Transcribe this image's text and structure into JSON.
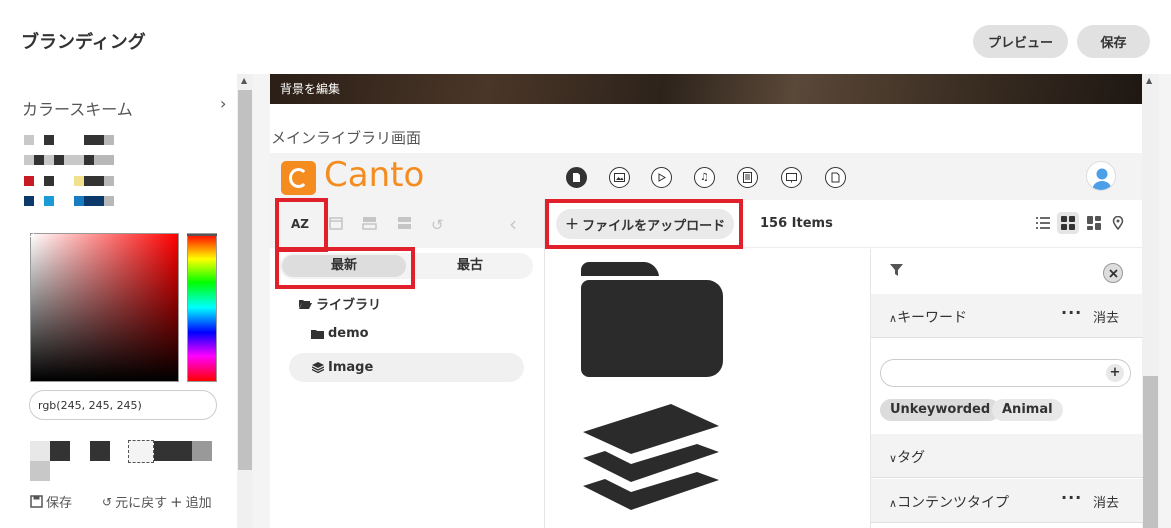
{
  "header": {
    "title": "ブランディング",
    "preview_label": "プレビュー",
    "save_label": "保存"
  },
  "left_panel": {
    "section_title": "カラースキーム",
    "rgb_value": "rgb(245, 245, 245)",
    "actions": {
      "save": "保存",
      "undo": "元に戻す",
      "add": "追加"
    }
  },
  "canvas": {
    "banner_label": "背景を編集",
    "section_label": "メインライブラリ画面"
  },
  "mock": {
    "logo_text": "Canto",
    "sort_new": "最新",
    "sort_old": "最古",
    "sort_az": "AZ",
    "tree": {
      "library": "ライブラリ",
      "demo": "demo",
      "image": "Image"
    },
    "upload_label": "ファイルをアップロード",
    "items_count": "156 Items",
    "filter": {
      "keyword_label": "キーワード",
      "keyword_clear": "消去",
      "chips": [
        "Unkeyworded",
        "Animal"
      ],
      "tag_label": "タグ",
      "content_type_label": "コンテンツタイプ",
      "content_type_clear": "消去"
    }
  },
  "colors": {
    "brand": "#f58c1f",
    "highlight": "#e0202a",
    "button_bg": "#e1e1e1"
  }
}
